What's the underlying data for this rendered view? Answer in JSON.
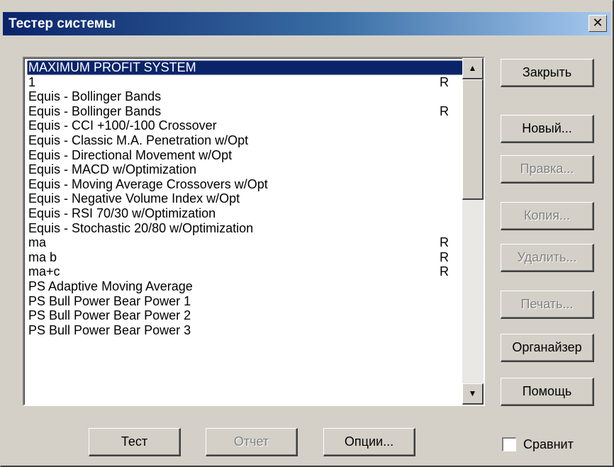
{
  "window": {
    "title": "Тестер системы",
    "close_glyph": "✕"
  },
  "list": {
    "items": [
      {
        "name": "MAXIMUM PROFIT SYSTEM",
        "flag": "",
        "selected": true
      },
      {
        "name": "1",
        "flag": "R"
      },
      {
        "name": "Equis - Bollinger Bands",
        "flag": ""
      },
      {
        "name": "Equis - Bollinger Bands",
        "flag": "R"
      },
      {
        "name": "Equis - CCI +100/-100 Crossover",
        "flag": ""
      },
      {
        "name": "Equis - Classic M.A. Penetration  w/Opt",
        "flag": ""
      },
      {
        "name": "Equis - Directional Movement  w/Opt",
        "flag": ""
      },
      {
        "name": "Equis - MACD  w/Optimization",
        "flag": ""
      },
      {
        "name": "Equis - Moving Average Crossovers w/Opt",
        "flag": ""
      },
      {
        "name": "Equis - Negative Volume Index  w/Opt",
        "flag": ""
      },
      {
        "name": "Equis - RSI 70/30 w/Optimization",
        "flag": ""
      },
      {
        "name": "Equis - Stochastic 20/80  w/Optimization",
        "flag": ""
      },
      {
        "name": "ma",
        "flag": "R"
      },
      {
        "name": "ma b",
        "flag": "R"
      },
      {
        "name": "ma+c",
        "flag": "R"
      },
      {
        "name": "PS Adaptive Moving Average",
        "flag": ""
      },
      {
        "name": "PS Bull Power Bear Power 1",
        "flag": ""
      },
      {
        "name": "PS Bull Power Bear Power 2",
        "flag": ""
      },
      {
        "name": "PS Bull Power Bear Power 3",
        "flag": ""
      }
    ],
    "scroll_up_glyph": "▲",
    "scroll_down_glyph": "▼"
  },
  "side_buttons": {
    "close": "Закрыть",
    "new": "Новый...",
    "edit": "Правка...",
    "copy": "Копия...",
    "delete": "Удалить...",
    "print": "Печать...",
    "organizer": "Органайзер",
    "help": "Помощь"
  },
  "bottom_buttons": {
    "test": "Тест",
    "report": "Отчет",
    "options": "Опции..."
  },
  "compare": {
    "label": "Сравнит",
    "checked": false
  }
}
